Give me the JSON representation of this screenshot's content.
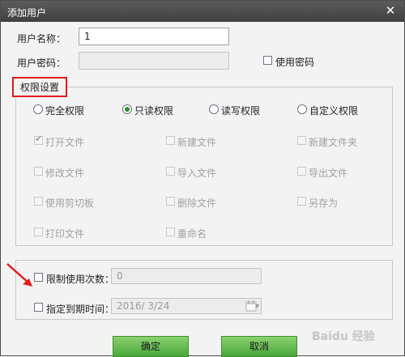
{
  "window": {
    "title": "添加用户",
    "close_glyph": "✕"
  },
  "form": {
    "username_label": "用户名称：",
    "username_value": "1",
    "password_label": "用户密码：",
    "use_password_label": "使用密码"
  },
  "permissions": {
    "group_title": "权限设置",
    "modes": [
      {
        "label": "完全权限",
        "selected": false
      },
      {
        "label": "只读权限",
        "selected": true
      },
      {
        "label": "读写权限",
        "selected": false
      },
      {
        "label": "自定义权限",
        "selected": false
      }
    ],
    "items": [
      {
        "label": "打开文件",
        "checked": true
      },
      {
        "label": "新建文件",
        "checked": false
      },
      {
        "label": "新建文件夹",
        "checked": false
      },
      {
        "label": "修改文件",
        "checked": false
      },
      {
        "label": "导入文件",
        "checked": false
      },
      {
        "label": "导出文件",
        "checked": false
      },
      {
        "label": "使用剪切板",
        "checked": false
      },
      {
        "label": "删除文件",
        "checked": false
      },
      {
        "label": "另存为",
        "checked": false
      },
      {
        "label": "打印文件",
        "checked": false
      },
      {
        "label": "重命名",
        "checked": false
      }
    ]
  },
  "limits": {
    "limit_uses_label": "限制使用次数：",
    "limit_uses_value": "0",
    "expiry_label": "指定到期时间：",
    "expiry_value": "2016/  3/24"
  },
  "buttons": {
    "ok": "确定",
    "cancel": "取消"
  },
  "watermark": "Baidu 经验",
  "colors": {
    "titlebar": "#4a4a4a",
    "highlight_box": "#e21b1b",
    "button_green": "#5bb548",
    "arrow": "#e21b1b"
  }
}
